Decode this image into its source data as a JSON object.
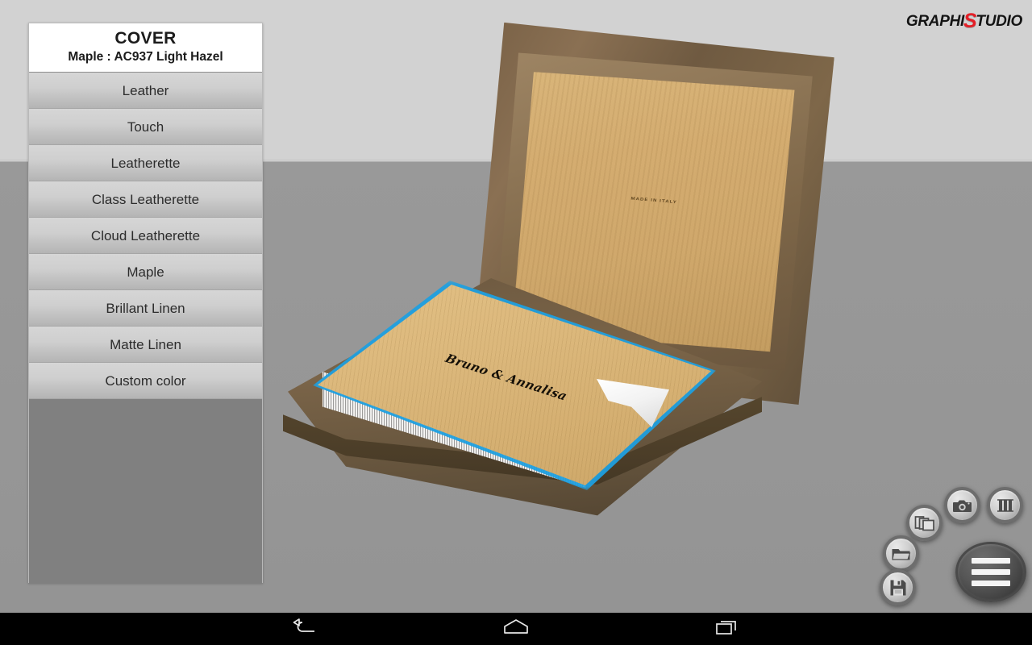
{
  "app": {
    "brand_prefix": "GRAPHI",
    "brand_mark": "S",
    "brand_suffix": "TUDIO",
    "accent_color": "#e41e26",
    "selection_color": "#1fa0e0"
  },
  "sidebar": {
    "title": "COVER",
    "subtitle": "Maple : AC937 Light Hazel",
    "items": [
      {
        "label": "Leather"
      },
      {
        "label": "Touch"
      },
      {
        "label": "Leatherette"
      },
      {
        "label": "Class Leatherette"
      },
      {
        "label": "Cloud Leatherette"
      },
      {
        "label": "Maple"
      },
      {
        "label": "Brillant Linen"
      },
      {
        "label": "Matte Linen"
      },
      {
        "label": "Custom color"
      }
    ]
  },
  "scene": {
    "lid_engraving": "MADE IN ITALY",
    "cover_engraving": "Bruno & Annalisa",
    "background_top_color": "#d2d2d2",
    "background_bottom_color": "#999999"
  },
  "toolbar": {
    "buttons": [
      {
        "name": "layout-icon",
        "label": "Layout"
      },
      {
        "name": "camera-icon",
        "label": "Camera"
      },
      {
        "name": "copy-icon",
        "label": "Duplicate"
      },
      {
        "name": "folder-icon",
        "label": "Open"
      },
      {
        "name": "save-icon",
        "label": "Save"
      },
      {
        "name": "hamburger-icon",
        "label": "Menu"
      }
    ]
  },
  "navbar": {
    "buttons": [
      {
        "name": "back-icon",
        "label": "Back"
      },
      {
        "name": "home-icon",
        "label": "Home"
      },
      {
        "name": "recents-icon",
        "label": "Recents"
      }
    ]
  }
}
